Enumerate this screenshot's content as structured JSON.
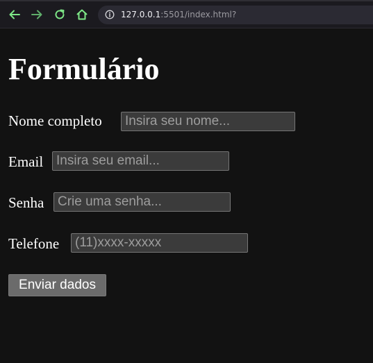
{
  "browser": {
    "url_host": "127.0.0.1",
    "url_rest": ":5501/index.html?",
    "nav_icons": [
      "back-arrow-icon",
      "forward-arrow-icon",
      "reload-icon",
      "home-icon",
      "info-icon"
    ],
    "icon_color": "#7ee787"
  },
  "page": {
    "title": "Formulário"
  },
  "form": {
    "fields": [
      {
        "label": "Nome completo",
        "placeholder": "Insira seu nome...",
        "value": ""
      },
      {
        "label": "Email",
        "placeholder": "Insira seu email...",
        "value": ""
      },
      {
        "label": "Senha",
        "placeholder": "Crie uma senha...",
        "value": ""
      },
      {
        "label": "Telefone",
        "placeholder": "(11)xxxx-xxxxx",
        "value": ""
      }
    ],
    "submit_label": "Enviar dados"
  },
  "colors": {
    "page_background": "#121212",
    "input_background": "#3b3b3b",
    "button_background": "#6b6b6b",
    "toolbar_background": "#1b1a1f"
  }
}
